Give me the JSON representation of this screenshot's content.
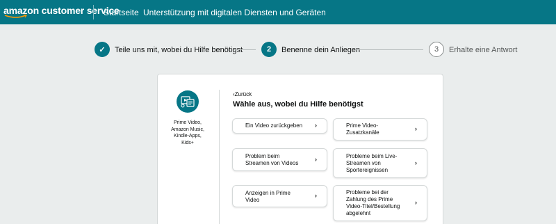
{
  "header": {
    "logo_text": "amazon customer service",
    "nav": [
      "Startseite",
      "Unterstützung mit digitalen Diensten und Geräten"
    ]
  },
  "stepper": {
    "steps": [
      {
        "number": "✓",
        "label": "Teile uns mit, wobei du Hilfe benötigst",
        "state": "done"
      },
      {
        "number": "2",
        "label": "Benenne dein Anliegen",
        "state": "active"
      },
      {
        "number": "3",
        "label": "Erhalte eine Antwort",
        "state": "todo"
      }
    ]
  },
  "category": {
    "icon": "prime-video-devices-icon",
    "name_lines": [
      "Prime Video,",
      "Amazon Music,",
      "Kindle-Apps,",
      "Kids+"
    ]
  },
  "panel": {
    "back_label": "Zurück",
    "heading": "Wähle aus, wobei du Hilfe benötigst",
    "options": [
      {
        "lines": [
          "Ein Video zurückgeben"
        ]
      },
      {
        "lines": [
          "Prime Video-",
          "Zusatzkanäle"
        ]
      },
      {
        "lines": [
          "Problem beim",
          "Streamen von Videos"
        ]
      },
      {
        "lines": [
          "Probleme beim Live-",
          "Streamen von",
          "Sportereignissen"
        ]
      },
      {
        "lines": [
          "Anzeigen in Prime",
          "Video"
        ]
      },
      {
        "lines": [
          "Probleme bei der",
          "Zahlung des Prime",
          "Video-Titel/Bestellung",
          "abgelehnt"
        ]
      }
    ]
  },
  "colors": {
    "brand": "#067686",
    "background": "#eaeded",
    "card": "#ffffff"
  }
}
